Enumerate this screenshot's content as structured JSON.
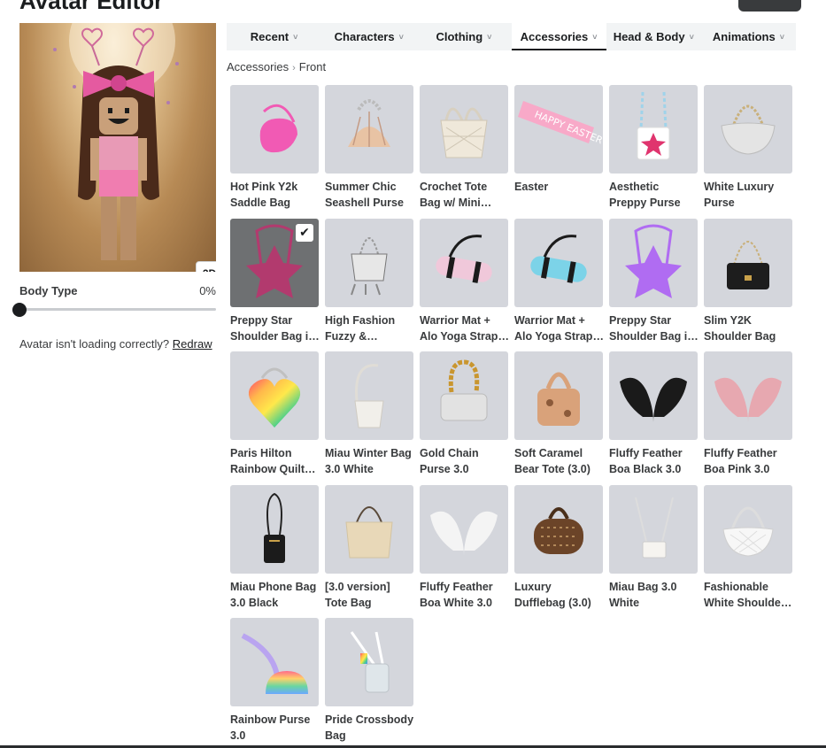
{
  "header": {
    "title": "Avatar Editor"
  },
  "avatar": {
    "view_toggle": "2D",
    "body_type_label": "Body Type",
    "body_type_value": "0%",
    "body_type_level": 0,
    "loading_text": "Avatar isn't loading correctly?",
    "redraw_label": "Redraw"
  },
  "tabs": [
    {
      "label": "Recent",
      "active": false
    },
    {
      "label": "Characters",
      "active": false
    },
    {
      "label": "Clothing",
      "active": false
    },
    {
      "label": "Accessories",
      "active": true
    },
    {
      "label": "Head & Body",
      "active": false
    },
    {
      "label": "Animations",
      "active": false
    }
  ],
  "breadcrumb": {
    "parent": "Accessories",
    "current": "Front"
  },
  "items": [
    {
      "name": "Hot Pink Y2k Saddle Bag",
      "icon": "saddle-bag-icon",
      "color": "#f15ab4",
      "selected": false
    },
    {
      "name": "Summer Chic Seashell Purse",
      "icon": "seashell-purse-icon",
      "color": "#e8c3a4",
      "selected": false
    },
    {
      "name": "Crochet Tote Bag w/ Mini Bows",
      "icon": "crochet-tote-icon",
      "color": "#efe8da",
      "selected": false
    },
    {
      "name": "Easter",
      "icon": "easter-sash-icon",
      "color": "#f8a9c8",
      "selected": false
    },
    {
      "name": "Aesthetic Preppy Purse",
      "icon": "star-purse-icon",
      "color": "#ffffff",
      "selected": false
    },
    {
      "name": "White Luxury Purse",
      "icon": "luxury-purse-icon",
      "color": "#e4e4e4",
      "selected": false
    },
    {
      "name": "Preppy Star Shoulder Bag in Pink",
      "icon": "star-shoulder-bag-icon",
      "color": "#b23a6e",
      "selected": true
    },
    {
      "name": "High Fashion Fuzzy & Fabulous",
      "icon": "fuzzy-bag-icon",
      "color": "#e7e7e7",
      "selected": false
    },
    {
      "name": "Warrior Mat + Alo Yoga Strap Pink",
      "icon": "yoga-mat-icon",
      "color": "#f0c8da",
      "selected": false
    },
    {
      "name": "Warrior Mat + Alo Yoga Strap Blue",
      "icon": "yoga-mat-icon",
      "color": "#7cd3e8",
      "selected": false
    },
    {
      "name": "Preppy Star Shoulder Bag in Purple",
      "icon": "star-shoulder-bag-icon",
      "color": "#b06cf2",
      "selected": false
    },
    {
      "name": "Slim Y2K Shoulder Bag",
      "icon": "slim-shoulder-bag-icon",
      "color": "#1d1d1d",
      "selected": false
    },
    {
      "name": "Paris Hilton Rainbow Quilted Heart",
      "icon": "rainbow-heart-bag-icon",
      "color": "#ff6f9f",
      "selected": false
    },
    {
      "name": "Miau Winter Bag 3.0 White",
      "icon": "bucket-bag-icon",
      "color": "#f1efea",
      "selected": false
    },
    {
      "name": "Gold Chain Purse 3.0",
      "icon": "chain-purse-icon",
      "color": "#e2e2e2",
      "selected": false
    },
    {
      "name": "Soft Caramel Bear Tote (3.0)",
      "icon": "bear-tote-icon",
      "color": "#d9a27a",
      "selected": false
    },
    {
      "name": "Fluffy Feather Boa Black 3.0",
      "icon": "feather-boa-icon",
      "color": "#1a1a1a",
      "selected": false
    },
    {
      "name": "Fluffy Feather Boa Pink 3.0",
      "icon": "feather-boa-icon",
      "color": "#e7a8b0",
      "selected": false
    },
    {
      "name": "Miau Phone Bag 3.0 Black",
      "icon": "phone-bag-icon",
      "color": "#1b1b1b",
      "selected": false
    },
    {
      "name": "[3.0 version] Tote Bag",
      "icon": "tote-bag-icon",
      "color": "#e8d8b8",
      "selected": false
    },
    {
      "name": "Fluffy Feather Boa White 3.0",
      "icon": "feather-boa-icon",
      "color": "#f4f4f4",
      "selected": false
    },
    {
      "name": "Luxury Dufflebag (3.0)",
      "icon": "duffle-bag-icon",
      "color": "#6b4428",
      "selected": false
    },
    {
      "name": "Miau Bag 3.0 White",
      "icon": "mini-bag-icon",
      "color": "#f6f4f0",
      "selected": false
    },
    {
      "name": "Fashionable White Shoulder Bag",
      "icon": "quilted-shoulder-bag-icon",
      "color": "#f7f7f7",
      "selected": false
    },
    {
      "name": "Rainbow Purse 3.0",
      "icon": "rainbow-purse-icon",
      "color": "#b9a4f0",
      "selected": false
    },
    {
      "name": "Pride Crossbody Bag",
      "icon": "crossbody-bag-icon",
      "color": "#dfe6ea",
      "selected": false
    }
  ]
}
